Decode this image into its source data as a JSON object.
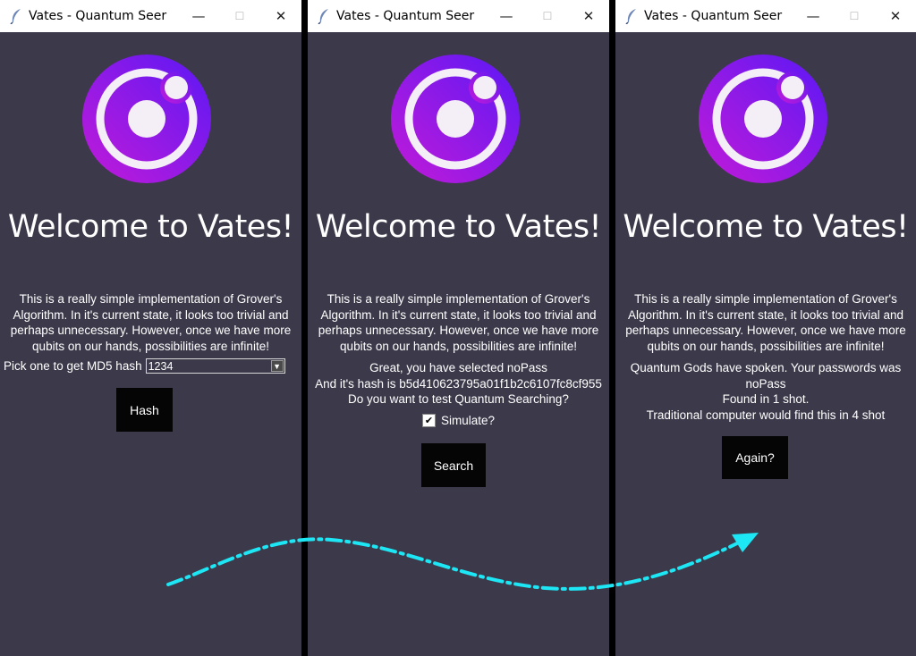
{
  "window_title": "Vates - Quantum Seer",
  "controls": {
    "minimize": "—",
    "maximize": "☐",
    "close": "✕"
  },
  "colors": {
    "window_bg": "#3c3a4a",
    "logo_gradient_start": "#c21bd8",
    "logo_gradient_end": "#5b18f5",
    "button_bg": "#050505",
    "arrow": "#1de6f5"
  },
  "icons": {
    "app": "feather-icon",
    "logo": "quantum-orbit-logo"
  },
  "welcome": "Welcome to Vates!",
  "description": [
    "This is a really simple implementation of Grover's",
    "Algorithm. In it's current state, it looks too trivial and",
    "perhaps unnecessary. However, once we have more",
    "qubits on our hands, possibilities are infinite!"
  ],
  "screen1": {
    "pick_label": "Pick one to get MD5 hash",
    "selected_value": "1234",
    "hash_button": "Hash"
  },
  "screen2": {
    "selected_line": "Great, you have selected noPass",
    "hash_line": "And it's hash is b5d410623795a01f1b2c6107fc8cf955",
    "question": "Do you want to test Quantum Searching?",
    "simulate_label": "Simulate?",
    "simulate_checked": true,
    "search_button": "Search"
  },
  "screen3": {
    "result_line1": "Quantum Gods have spoken. Your passwords was",
    "result_line2": "noPass",
    "result_line3": "Found in 1 shot.",
    "result_line4": "Traditional computer would find this in 4 shot",
    "again_button": "Again?"
  }
}
